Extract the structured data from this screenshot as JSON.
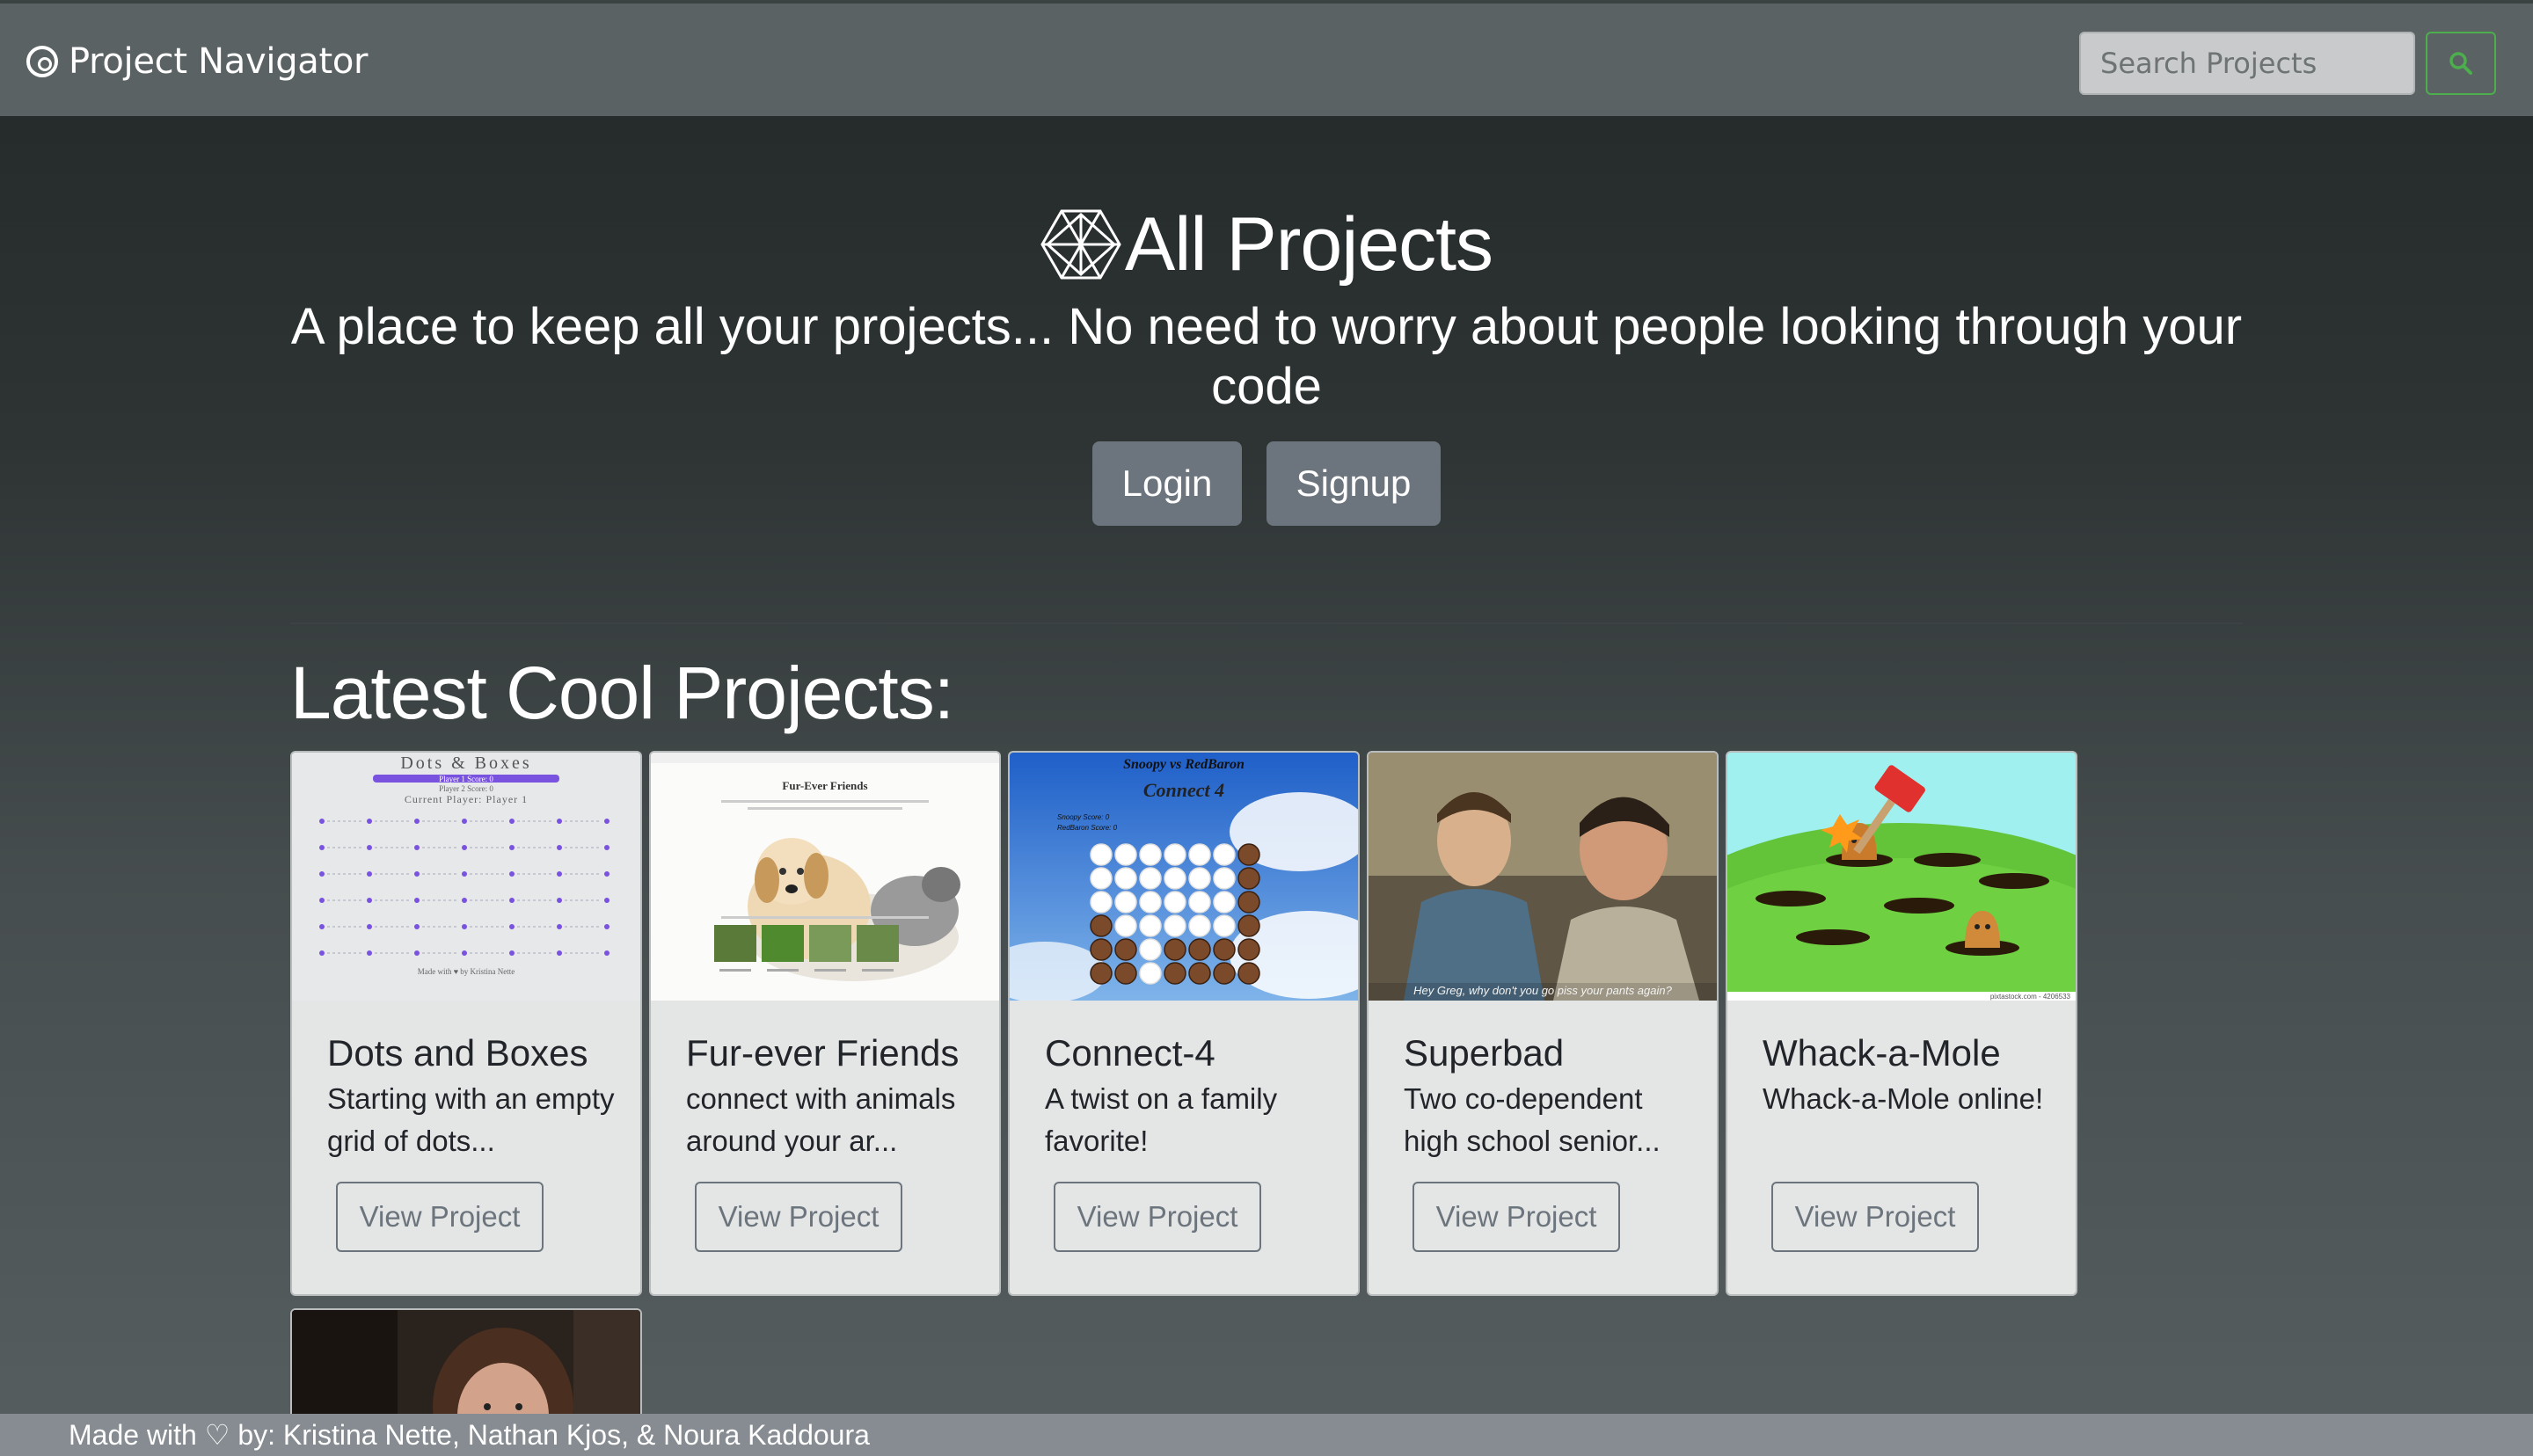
{
  "navbar": {
    "brand": "Project Navigator",
    "brand_icon": "compass-icon",
    "search_placeholder": "Search Projects",
    "search_icon": "search-icon",
    "accent_color": "#4cae4c"
  },
  "hero": {
    "title": "All Projects",
    "title_icon": "hexagon-logo-icon",
    "subtitle": "A place to keep all your projects... No need to worry about people looking through your code",
    "login_label": "Login",
    "signup_label": "Signup"
  },
  "section": {
    "title": "Latest Cool Projects:"
  },
  "cards": [
    {
      "title": "Dots and Boxes",
      "text": "Starting with an empty grid of dots...",
      "button": "View Project",
      "thumb": {
        "heading": "Dots & Boxes",
        "line1": "Player 1 Score: 0",
        "line2": "Player 2 Score: 0",
        "line3": "Current Player: Player 1",
        "credit": "Made with ♥ by Kristina Nette"
      }
    },
    {
      "title": "Fur-ever Friends",
      "text": "connect with animals around your ar...",
      "button": "View Project",
      "thumb": {
        "heading": "Fur-Ever Friends"
      }
    },
    {
      "title": "Connect-4",
      "text": "A twist on a family favorite!",
      "button": "View Project",
      "thumb": {
        "heading": "Snoopy vs RedBaron",
        "logo": "Connect 4",
        "score1": "Snoopy Score: 0",
        "score2": "RedBaron Score: 0"
      }
    },
    {
      "title": "Superbad",
      "text": "Two co-dependent high school senior...",
      "button": "View Project",
      "thumb": {
        "caption": "Hey Greg, why don't you go piss your pants again?"
      }
    },
    {
      "title": "Whack-a-Mole",
      "text": "Whack-a-Mole online!",
      "button": "View Project",
      "thumb": {
        "watermark": "pixtastock.com - 4206533"
      }
    }
  ],
  "footer": {
    "text": "Made with ♡ by: Kristina Nette, Nathan Kjos, & Noura Kaddoura"
  }
}
